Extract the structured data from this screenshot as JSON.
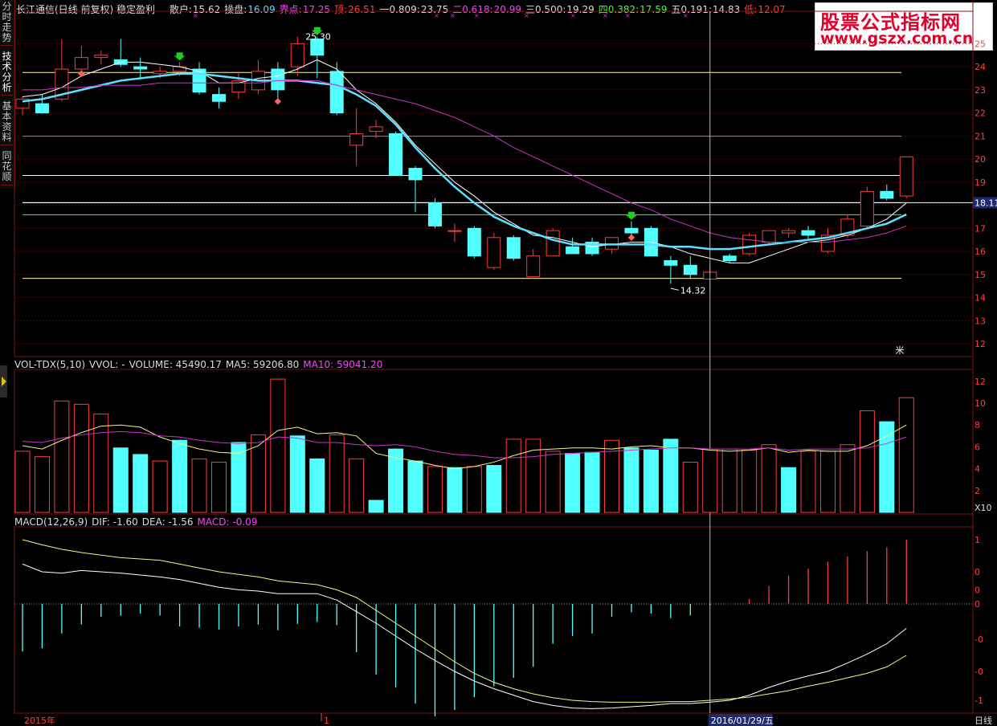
{
  "header": {
    "title": "长江通信(日线 前复权) 稳定盈利",
    "fields": [
      {
        "label": "散户:",
        "value": "15.62",
        "color": "#dddddd",
        "vcolor": "#dddddd"
      },
      {
        "label": "操盘:",
        "value": "16.09",
        "color": "#dddddd",
        "vcolor": "#5fdfff"
      },
      {
        "label": "界点:",
        "value": "17.25",
        "color": "#ff40ff",
        "vcolor": "#ff40ff"
      },
      {
        "label": "顶:",
        "value": "26.51",
        "color": "#ff4040",
        "vcolor": "#ff4040"
      },
      {
        "label": "一0.809:",
        "value": "23.75",
        "color": "#dddddd",
        "vcolor": "#dddddd"
      },
      {
        "label": "二0.618:",
        "value": "20.99",
        "color": "#ff40ff",
        "vcolor": "#ff40ff"
      },
      {
        "label": "三0.500:",
        "value": "19.29",
        "color": "#dddddd",
        "vcolor": "#dddddd"
      },
      {
        "label": "四0.382:",
        "value": "17.59",
        "color": "#40ff40",
        "vcolor": "#40ff40"
      },
      {
        "label": "五0.191:",
        "value": "14.83",
        "color": "#dddddd",
        "vcolor": "#dddddd"
      },
      {
        "label": "低:",
        "value": "12.07",
        "color": "#ff4040",
        "vcolor": "#ff4040"
      }
    ]
  },
  "side_tabs": [
    "分时走势",
    "技术分析",
    "基本资料",
    "同花顺"
  ],
  "watermark": {
    "line1": "股票公式指标网",
    "line2": "www.gszx.com.cn"
  },
  "price_panel": {
    "ticks": [
      "25",
      "24",
      "23",
      "22",
      "21",
      "20",
      "19",
      "18",
      "17",
      "16",
      "15",
      "14",
      "13",
      "12"
    ],
    "current_price": "18.11",
    "high_label": "25.30",
    "low_label": "14.32",
    "corner_mark": "米"
  },
  "volume_panel": {
    "header": [
      {
        "text": "VOL-TDX(5,10)",
        "color": "#dddddd"
      },
      {
        "text": "VVOL: -",
        "color": "#dddddd"
      },
      {
        "text": "VOLUME: 45490.17",
        "color": "#dddddd"
      },
      {
        "text": "MA5: 59206.80",
        "color": "#dddddd"
      },
      {
        "text": "MA10: 59041.20",
        "color": "#ff40ff"
      }
    ],
    "ticks": [
      "12",
      "10",
      "8",
      "6",
      "4",
      "2"
    ],
    "unit": "X10"
  },
  "macd_panel": {
    "header": [
      {
        "text": "MACD(12,26,9)",
        "color": "#dddddd"
      },
      {
        "text": "DIF: -1.60",
        "color": "#dddddd"
      },
      {
        "text": "DEA: -1.56",
        "color": "#dddddd"
      },
      {
        "text": "MACD: -0.09",
        "color": "#ff40ff"
      }
    ],
    "ticks": [
      "1",
      "0",
      "0",
      "0",
      "-0",
      "-0",
      "-1"
    ]
  },
  "footer": {
    "year": "2015年",
    "month": "1",
    "cursor_date": "2016/01/29/五",
    "period": "日线"
  },
  "colors": {
    "up": "#ff3c3c",
    "down": "#52ffff",
    "grid": "#7a1010",
    "ma5": "#ffffff",
    "ma10": "#5fdfff",
    "ma20": "#cc33cc",
    "dif": "#ffffff",
    "dea": "#f5f58a"
  },
  "chart_data": {
    "type": "candlestick",
    "price_axis": {
      "min": 12,
      "max": 25.5
    },
    "levels": [
      {
        "name": "一0.809",
        "value": 23.75,
        "color": "#ffffaa"
      },
      {
        "name": "二0.618",
        "value": 20.99,
        "color": "#ff40ff"
      },
      {
        "name": "三0.500",
        "value": 19.29,
        "color": "#ffffff"
      },
      {
        "name": "四0.382",
        "value": 17.59,
        "color": "#40ff40"
      },
      {
        "name": "五0.191",
        "value": 14.83,
        "color": "#ffffaa"
      },
      {
        "name": "当前",
        "value": 18.11,
        "color": "#ffffff"
      }
    ],
    "candles": [
      {
        "o": 22.2,
        "h": 22.7,
        "l": 21.9,
        "c": 22.6
      },
      {
        "o": 22.4,
        "h": 22.8,
        "l": 22.1,
        "c": 22.0
      },
      {
        "o": 22.6,
        "h": 25.2,
        "l": 22.5,
        "c": 23.9
      },
      {
        "o": 23.9,
        "h": 24.9,
        "l": 23.7,
        "c": 24.4
      },
      {
        "o": 24.4,
        "h": 24.7,
        "l": 24.1,
        "c": 24.5
      },
      {
        "o": 24.3,
        "h": 25.2,
        "l": 24.0,
        "c": 24.1
      },
      {
        "o": 24.0,
        "h": 24.4,
        "l": 23.5,
        "c": 23.9
      },
      {
        "o": 23.7,
        "h": 24.0,
        "l": 23.5,
        "c": 23.8
      },
      {
        "o": 23.8,
        "h": 24.2,
        "l": 23.6,
        "c": 24.0
      },
      {
        "o": 23.9,
        "h": 24.2,
        "l": 22.8,
        "c": 22.9
      },
      {
        "o": 22.8,
        "h": 23.1,
        "l": 22.2,
        "c": 22.5
      },
      {
        "o": 22.9,
        "h": 23.8,
        "l": 22.6,
        "c": 23.4
      },
      {
        "o": 23.0,
        "h": 24.3,
        "l": 22.8,
        "c": 23.8
      },
      {
        "o": 23.9,
        "h": 24.2,
        "l": 22.5,
        "c": 23.0
      },
      {
        "o": 24.0,
        "h": 25.3,
        "l": 23.6,
        "c": 25.0
      },
      {
        "o": 25.2,
        "h": 25.3,
        "l": 23.5,
        "c": 24.5
      },
      {
        "o": 23.8,
        "h": 24.2,
        "l": 21.9,
        "c": 22.0
      },
      {
        "o": 20.6,
        "h": 22.2,
        "l": 19.7,
        "c": 21.1
      },
      {
        "o": 21.2,
        "h": 21.7,
        "l": 20.9,
        "c": 21.4
      },
      {
        "o": 21.1,
        "h": 21.2,
        "l": 19.3,
        "c": 19.3
      },
      {
        "o": 19.6,
        "h": 19.7,
        "l": 17.7,
        "c": 19.1
      },
      {
        "o": 18.1,
        "h": 18.3,
        "l": 17.0,
        "c": 17.1
      },
      {
        "o": 16.9,
        "h": 17.2,
        "l": 16.4,
        "c": 16.9
      },
      {
        "o": 17.0,
        "h": 17.1,
        "l": 15.7,
        "c": 15.8
      },
      {
        "o": 15.3,
        "h": 16.8,
        "l": 15.2,
        "c": 16.6
      },
      {
        "o": 16.6,
        "h": 16.7,
        "l": 15.6,
        "c": 15.7
      },
      {
        "o": 14.9,
        "h": 16.1,
        "l": 14.8,
        "c": 15.8
      },
      {
        "o": 15.8,
        "h": 17.0,
        "l": 15.8,
        "c": 16.9
      },
      {
        "o": 16.2,
        "h": 16.6,
        "l": 16.0,
        "c": 15.9
      },
      {
        "o": 16.4,
        "h": 16.6,
        "l": 15.8,
        "c": 15.9
      },
      {
        "o": 16.1,
        "h": 16.5,
        "l": 15.9,
        "c": 16.6
      },
      {
        "o": 17.0,
        "h": 17.3,
        "l": 16.6,
        "c": 16.8
      },
      {
        "o": 17.0,
        "h": 17.1,
        "l": 15.8,
        "c": 15.8
      },
      {
        "o": 15.6,
        "h": 15.8,
        "l": 14.6,
        "c": 15.4
      },
      {
        "o": 15.4,
        "h": 15.8,
        "l": 14.8,
        "c": 15.0
      },
      {
        "o": 14.8,
        "h": 15.4,
        "l": 14.3,
        "c": 15.1
      },
      {
        "o": 15.8,
        "h": 15.9,
        "l": 15.5,
        "c": 15.6
      },
      {
        "o": 15.9,
        "h": 16.8,
        "l": 15.8,
        "c": 16.7
      },
      {
        "o": 16.4,
        "h": 16.9,
        "l": 16.3,
        "c": 16.9
      },
      {
        "o": 16.8,
        "h": 17.0,
        "l": 16.6,
        "c": 16.9
      },
      {
        "o": 16.9,
        "h": 17.1,
        "l": 16.5,
        "c": 16.7
      },
      {
        "o": 16.0,
        "h": 17.0,
        "l": 15.9,
        "c": 16.7
      },
      {
        "o": 16.7,
        "h": 17.6,
        "l": 16.6,
        "c": 17.4
      },
      {
        "o": 17.1,
        "h": 18.8,
        "l": 17.0,
        "c": 18.6
      },
      {
        "o": 18.6,
        "h": 18.9,
        "l": 18.2,
        "c": 18.3
      },
      {
        "o": 18.4,
        "h": 20.1,
        "l": 18.3,
        "c": 20.1
      }
    ],
    "ma": [
      {
        "name": "MA5",
        "color": "#ffffff",
        "values": [
          22.7,
          22.8,
          23.1,
          23.6,
          23.9,
          24.2,
          24.2,
          24.1,
          24.0,
          23.8,
          23.3,
          23.3,
          23.5,
          23.6,
          23.9,
          24.3,
          23.9,
          23.0,
          22.4,
          21.6,
          20.6,
          19.8,
          19.0,
          18.4,
          17.7,
          17.2,
          16.7,
          16.6,
          16.4,
          16.2,
          16.3,
          16.4,
          16.4,
          16.2,
          15.9,
          15.7,
          15.5,
          15.5,
          15.8,
          16.1,
          16.4,
          16.5,
          16.7,
          17.0,
          17.4,
          18.1
        ]
      },
      {
        "name": "MA10",
        "color": "#5fdfff",
        "values": [
          22.5,
          22.6,
          22.8,
          23.0,
          23.2,
          23.4,
          23.5,
          23.6,
          23.7,
          23.7,
          23.6,
          23.5,
          23.4,
          23.4,
          23.4,
          23.3,
          23.2,
          22.8,
          22.3,
          21.5,
          20.5,
          19.6,
          18.8,
          18.1,
          17.5,
          17.1,
          16.8,
          16.5,
          16.3,
          16.3,
          16.3,
          16.3,
          16.3,
          16.2,
          16.2,
          16.1,
          16.1,
          16.2,
          16.3,
          16.4,
          16.5,
          16.6,
          16.8,
          17.0,
          17.2,
          17.6
        ]
      },
      {
        "name": "MA20",
        "color": "#cc33cc",
        "values": [
          23.0,
          23.0,
          23.1,
          23.1,
          23.2,
          23.2,
          23.2,
          23.3,
          23.3,
          23.3,
          23.3,
          23.3,
          23.3,
          23.4,
          23.4,
          23.4,
          23.2,
          23.0,
          22.8,
          22.6,
          22.4,
          22.1,
          21.8,
          21.4,
          21.0,
          20.5,
          20.1,
          19.7,
          19.3,
          18.9,
          18.5,
          18.1,
          17.8,
          17.4,
          17.1,
          16.8,
          16.6,
          16.5,
          16.4,
          16.4,
          16.4,
          16.4,
          16.5,
          16.6,
          16.8,
          17.1
        ]
      }
    ],
    "volume": {
      "axis": [
        0,
        12.5
      ],
      "bars": [
        {
          "v": 5.6,
          "d": 0
        },
        {
          "v": 5.1,
          "d": 0
        },
        {
          "v": 10.2,
          "d": 0
        },
        {
          "v": 9.9,
          "d": 0
        },
        {
          "v": 9.0,
          "d": 0
        },
        {
          "v": 5.9,
          "d": 1
        },
        {
          "v": 5.3,
          "d": 1
        },
        {
          "v": 4.7,
          "d": 0
        },
        {
          "v": 6.6,
          "d": 1
        },
        {
          "v": 4.9,
          "d": 0
        },
        {
          "v": 4.6,
          "d": 0
        },
        {
          "v": 6.4,
          "d": 1
        },
        {
          "v": 7.1,
          "d": 0
        },
        {
          "v": 12.2,
          "d": 0
        },
        {
          "v": 7.0,
          "d": 1
        },
        {
          "v": 4.9,
          "d": 1
        },
        {
          "v": 7.1,
          "d": 0
        },
        {
          "v": 4.9,
          "d": 0
        },
        {
          "v": 1.1,
          "d": 1
        },
        {
          "v": 5.8,
          "d": 1
        },
        {
          "v": 4.7,
          "d": 1
        },
        {
          "v": 4.2,
          "d": 0
        },
        {
          "v": 4.1,
          "d": 1
        },
        {
          "v": 4.2,
          "d": 0
        },
        {
          "v": 4.3,
          "d": 1
        },
        {
          "v": 6.7,
          "d": 0
        },
        {
          "v": 6.7,
          "d": 0
        },
        {
          "v": 5.6,
          "d": 0
        },
        {
          "v": 5.4,
          "d": 1
        },
        {
          "v": 5.5,
          "d": 1
        },
        {
          "v": 6.6,
          "d": 0
        },
        {
          "v": 5.9,
          "d": 1
        },
        {
          "v": 5.7,
          "d": 1
        },
        {
          "v": 6.7,
          "d": 1
        },
        {
          "v": 4.6,
          "d": 0
        },
        {
          "v": 5.8,
          "d": 0
        },
        {
          "v": 5.8,
          "d": 0
        },
        {
          "v": 5.7,
          "d": 0
        },
        {
          "v": 6.2,
          "d": 0
        },
        {
          "v": 4.1,
          "d": 1
        },
        {
          "v": 5.6,
          "d": 0
        },
        {
          "v": 5.6,
          "d": 0
        },
        {
          "v": 6.2,
          "d": 0
        },
        {
          "v": 9.3,
          "d": 0
        },
        {
          "v": 8.3,
          "d": 1
        },
        {
          "v": 10.5,
          "d": 0
        }
      ],
      "ma5": [
        6.1,
        5.8,
        6.6,
        7.3,
        7.9,
        8.0,
        7.8,
        6.9,
        6.3,
        5.8,
        5.5,
        5.4,
        6.1,
        7.5,
        7.8,
        7.2,
        7.3,
        7.0,
        5.4,
        5.0,
        4.7,
        4.3,
        4.0,
        4.2,
        4.6,
        5.2,
        5.7,
        5.8,
        5.9,
        5.9,
        5.8,
        6.0,
        6.1,
        5.9,
        5.9,
        5.7,
        5.6,
        5.7,
        5.9,
        5.5,
        5.7,
        5.6,
        5.6,
        6.1,
        7.0,
        8.0
      ],
      "ma10": [
        6.5,
        6.4,
        6.8,
        7.1,
        7.3,
        7.4,
        7.3,
        7.0,
        6.9,
        6.6,
        6.4,
        6.3,
        6.4,
        6.9,
        6.8,
        6.4,
        6.4,
        6.2,
        6.1,
        6.2,
        6.0,
        5.6,
        5.3,
        5.2,
        5.0,
        5.0,
        5.1,
        5.3,
        5.4,
        5.5,
        5.6,
        5.7,
        5.8,
        5.9,
        5.9,
        5.8,
        5.8,
        5.8,
        5.9,
        5.7,
        5.8,
        5.8,
        5.8,
        5.9,
        6.3,
        6.9
      ]
    },
    "macd": {
      "axis": [
        -1.6,
        1.05
      ],
      "dif": [
        0.62,
        0.5,
        0.48,
        0.52,
        0.5,
        0.48,
        0.45,
        0.42,
        0.38,
        0.32,
        0.26,
        0.22,
        0.2,
        0.16,
        0.16,
        0.16,
        0.06,
        -0.12,
        -0.3,
        -0.5,
        -0.7,
        -0.88,
        -1.05,
        -1.2,
        -1.32,
        -1.42,
        -1.52,
        -1.58,
        -1.62,
        -1.63,
        -1.62,
        -1.6,
        -1.58,
        -1.55,
        -1.55,
        -1.53,
        -1.5,
        -1.42,
        -1.3,
        -1.2,
        -1.12,
        -1.05,
        -0.92,
        -0.78,
        -0.62,
        -0.38
      ],
      "dea": [
        1.0,
        0.92,
        0.85,
        0.8,
        0.76,
        0.72,
        0.7,
        0.68,
        0.62,
        0.56,
        0.5,
        0.46,
        0.42,
        0.36,
        0.33,
        0.3,
        0.22,
        0.1,
        -0.1,
        -0.3,
        -0.5,
        -0.7,
        -0.9,
        -1.08,
        -1.22,
        -1.32,
        -1.4,
        -1.46,
        -1.5,
        -1.52,
        -1.53,
        -1.53,
        -1.53,
        -1.52,
        -1.52,
        -1.5,
        -1.48,
        -1.45,
        -1.4,
        -1.35,
        -1.28,
        -1.22,
        -1.15,
        -1.08,
        -0.98,
        -0.8
      ],
      "hist": [
        -0.74,
        -0.69,
        -0.46,
        -0.32,
        -0.2,
        -0.18,
        -0.15,
        -0.18,
        -0.35,
        -0.37,
        -0.4,
        -0.35,
        -0.32,
        -0.41,
        -0.31,
        -0.28,
        -0.33,
        -0.75,
        -1.1,
        -1.3,
        -1.55,
        -1.75,
        -1.65,
        -1.45,
        -1.28,
        -1.15,
        -0.98,
        -0.62,
        -0.5,
        -0.46,
        -0.2,
        -0.13,
        -0.15,
        -0.22,
        -0.18,
        -0.02,
        0.0,
        0.08,
        0.28,
        0.44,
        0.55,
        0.66,
        0.74,
        0.82,
        0.88,
        1.0
      ]
    },
    "cursor_index": 35
  }
}
